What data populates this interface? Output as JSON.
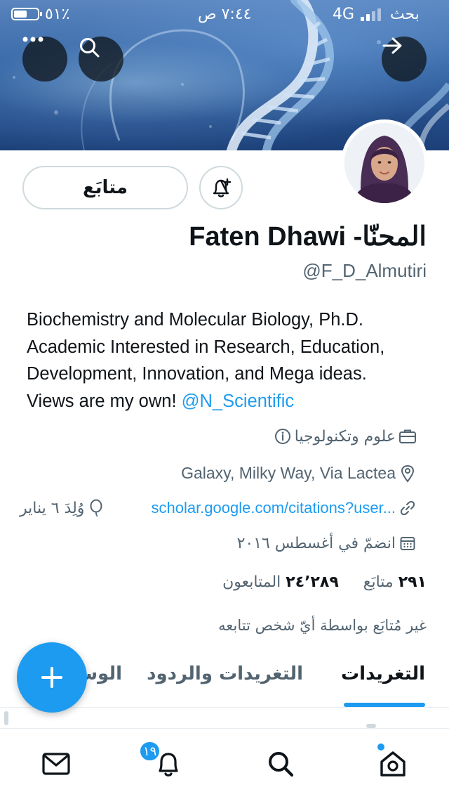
{
  "status_bar": {
    "battery": "٥١٪",
    "time": "٧:٤٤ ص",
    "network": "4G",
    "carrier": "بحث"
  },
  "header": {
    "back_icon": "arrow-right-icon",
    "search_icon": "search-icon",
    "more_icon": "more-dots-icon"
  },
  "profile": {
    "follow_label": "متابَع",
    "display_name": "Faten Dhawi -المحنّا",
    "handle": "@F_D_Almutiri",
    "bio_lines": [
      "Biochemistry and Molecular Biology, Ph.D.",
      "Academic Interested in Research, Education,",
      "Development, Innovation, and Mega ideas."
    ],
    "bio_last_prefix": "Views are my own! ",
    "bio_mention": "@N_Scientific",
    "category": "علوم وتكنولوجيا",
    "location": "Galaxy, Milky Way, Via Lactea",
    "website": "scholar.google.com/citations?user...",
    "birthday": "وُلِدَ ٦ يناير",
    "joined": "انضمّ في أغسطس ٢٠١٦",
    "following_count": "٢٩١",
    "following_label": "متابَع",
    "followers_count": "٢٤٬٢٨٩",
    "followers_label": "المتابعون",
    "not_followed_text": "غير مُتابَع بواسطة أيّ شخص تتابعه"
  },
  "tabs": [
    {
      "label": "التغريدات",
      "active": true
    },
    {
      "label": "التغريدات والردود",
      "active": false
    },
    {
      "label": "الوسائط",
      "active": false
    }
  ],
  "bottom_nav": {
    "notifications_badge": "١٩",
    "items": [
      "mail-icon",
      "bell-icon",
      "search-icon",
      "home-icon"
    ]
  },
  "colors": {
    "accent": "#1d9bf0",
    "text_primary": "#0f1419",
    "text_secondary": "#536471"
  }
}
